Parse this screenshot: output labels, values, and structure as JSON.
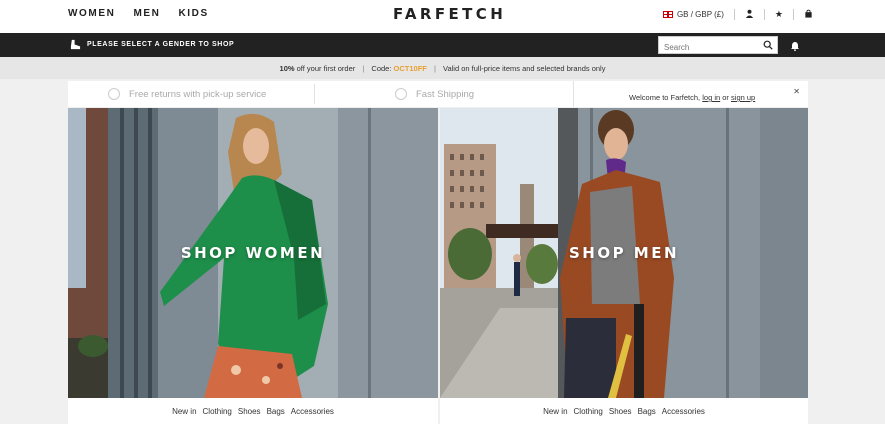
{
  "header": {
    "nav": [
      "WOMEN",
      "MEN",
      "KIDS"
    ],
    "logo": "FARFETCH",
    "region": "GB / GBP (£)"
  },
  "blackbar": {
    "gender_message": "PLEASE SELECT A GENDER TO SHOP",
    "search_placeholder": "Search"
  },
  "promo": {
    "discount": "10%",
    "offer_text": "off your first order",
    "code_label": "Code:",
    "code": "OCT10FF",
    "terms": "Valid on full-price items and selected brands only"
  },
  "services": {
    "returns": "Free returns with pick-up service",
    "shipping": "Fast Shipping"
  },
  "welcome": {
    "prefix": "Welcome to Farfetch,",
    "login": "log in",
    "or": "or",
    "signup": "sign up"
  },
  "hero": {
    "women_title": "SHOP WOMEN",
    "men_title": "SHOP MEN"
  },
  "links": {
    "women": [
      "New in",
      "Clothing",
      "Shoes",
      "Bags",
      "Accessories"
    ],
    "men": [
      "New in",
      "Clothing",
      "Shoes",
      "Bags",
      "Accessories"
    ]
  },
  "colors": {
    "accent_code": "#e8a030",
    "black_bar": "#222222"
  }
}
